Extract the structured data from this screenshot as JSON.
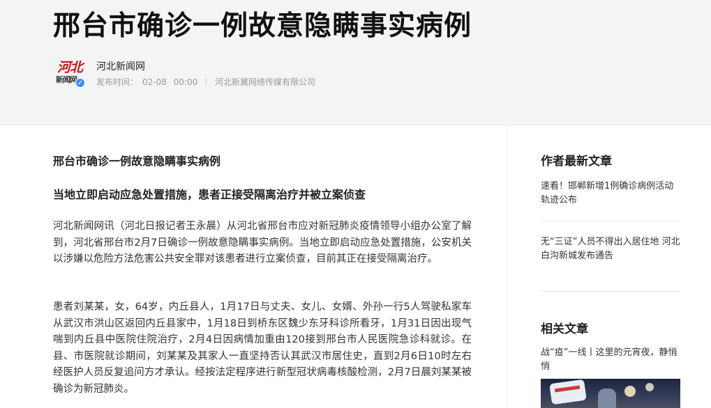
{
  "article": {
    "title": "邢台市确诊一例故意隐瞒事实病例"
  },
  "source": {
    "logo_text_top": "河北",
    "logo_text_bottom": "新闻网",
    "name": "河北新闻网",
    "publish_label": "发布时间：",
    "publish_date": "02-08",
    "publish_time": "00:00",
    "company": "河北新冀网络传媒有限公司"
  },
  "content": {
    "heading": "邢台市确诊一例故意隐瞒事实病例",
    "subheading": "当地立即启动应急处置措施，患者正接受隔离治疗并被立案侦查",
    "paragraphs": [
      "河北新闻网讯（河北日报记者王永晨）从河北省邢台市应对新冠肺炎疫情领导小组办公室了解到，河北省邢台市2月7日确诊一例故意隐瞒事实病例。当地立即启动应急处置措施，公安机关以涉嫌以危险方法危害公共安全罪对该患者进行立案侦查，目前其正在接受隔离治疗。",
      "患者刘某某，女，64岁，内丘县人，1月17日与丈夫、女儿、女婿、外孙一行5人驾驶私家车从武汉市洪山区返回内丘县家中，1月18日到桥东区魏少东牙科诊所看牙，1月31日因出现气喘到内丘县中医院住院治疗，2月4日因病情加重由120接到邢台市人民医院急诊科就诊。在县、市医院就诊期间，刘某某及其家人一直坚持否认其武汉市居住史，直到2月6日10时左右经医护人员反复追问方才承认。经按法定程序进行新型冠状病毒核酸检测，2月7日晨刘某某被确诊为新冠肺炎。"
    ]
  },
  "sidebar": {
    "author_latest_title": "作者最新文章",
    "author_articles": [
      "速看！邯郸新增1例确诊病例活动轨迹公布",
      "无“三证”人员不得出入居住地 河北白沟新城发布通告"
    ],
    "related_title": "相关文章",
    "related_articles": [
      "战“疫”一线丨这里的元宵夜，静悄悄"
    ]
  },
  "colors": {
    "header_bg": "#f4f4f4",
    "brand_red": "#c8161d",
    "verified_blue": "#3e8ef7"
  }
}
